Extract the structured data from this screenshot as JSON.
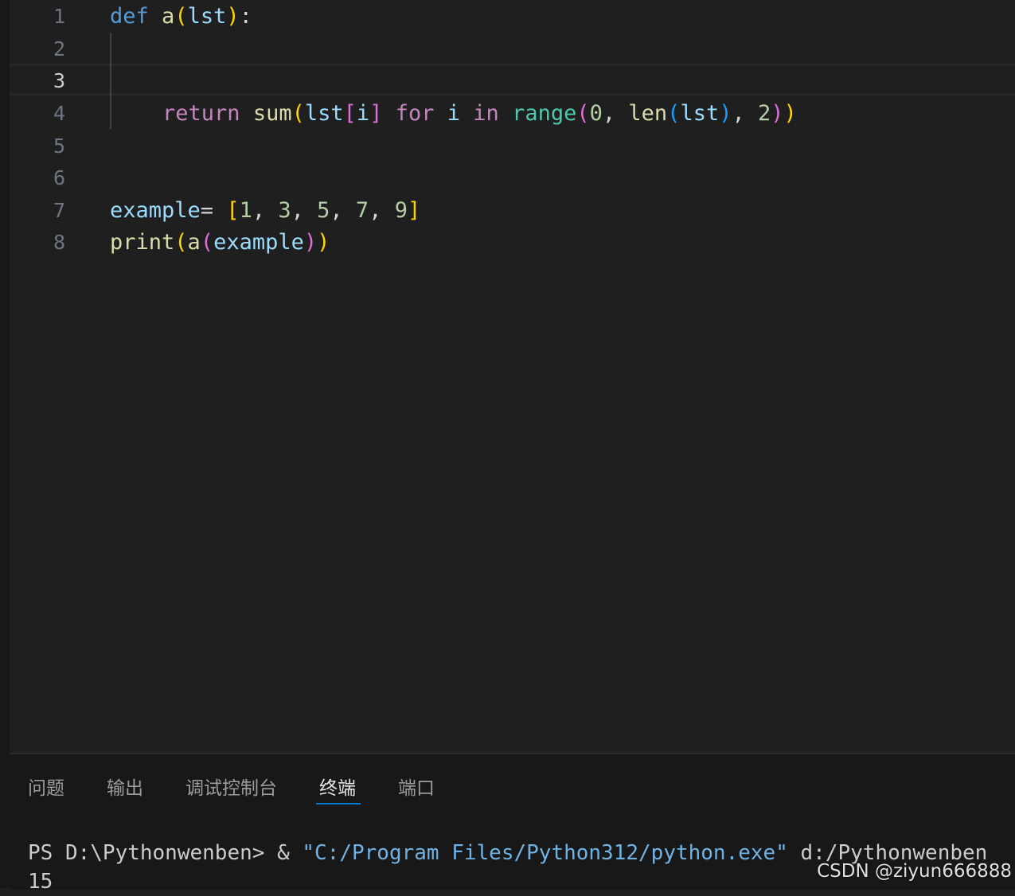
{
  "editor": {
    "line_numbers": [
      "1",
      "2",
      "3",
      "4",
      "5",
      "6",
      "7",
      "8"
    ],
    "active_line": "3",
    "code": {
      "line1": {
        "def": "def",
        "name": "a",
        "open": "(",
        "param": "lst",
        "close": ")",
        "colon": ":"
      },
      "line4": {
        "return": "return",
        "sum": "sum",
        "p1o": "(",
        "lst": "lst",
        "bo": "[",
        "i": "i",
        "bc": "]",
        "for": "for",
        "i2": "i",
        "in": "in",
        "range": "range",
        "p2o": "(",
        "zero": "0",
        "comma1": ", ",
        "len": "len",
        "p3o": "(",
        "lst2": "lst",
        "p3c": ")",
        "comma2": ", ",
        "two": "2",
        "p2c": ")",
        "p1c": ")"
      },
      "line7": {
        "example": "example",
        "eq": "= ",
        "bo": "[",
        "n1": "1",
        "c1": ", ",
        "n2": "3",
        "c2": ", ",
        "n3": "5",
        "c3": ", ",
        "n4": "7",
        "c4": ", ",
        "n5": "9",
        "bc": "]"
      },
      "line8": {
        "print": "print",
        "p1o": "(",
        "a": "a",
        "p2o": "(",
        "example": "example",
        "p2c": ")",
        "p1c": ")"
      }
    }
  },
  "panel": {
    "tabs": [
      "问题",
      "输出",
      "调试控制台",
      "终端",
      "端口"
    ],
    "active_tab": "终端",
    "terminal": {
      "prompt": "PS D:\\Pythonwenben> & ",
      "exe_path": "\"C:/Program Files/Python312/python.exe\"",
      "script_arg": " d:/Pythonwenben",
      "output": "15"
    }
  },
  "watermark": "CSDN @ziyun666888",
  "colors": {
    "background": "#1f1f1f",
    "keyword": "#569cd6",
    "control_keyword": "#c586c0",
    "function": "#dcdcaa",
    "variable": "#9cdcfe",
    "number": "#b5cea8",
    "bracket_level1": "#ffd700",
    "bracket_level2": "#da70d6",
    "bracket_level3": "#179fff",
    "terminal_string": "#6fb3e4",
    "active_tab_underline": "#0078d4"
  }
}
